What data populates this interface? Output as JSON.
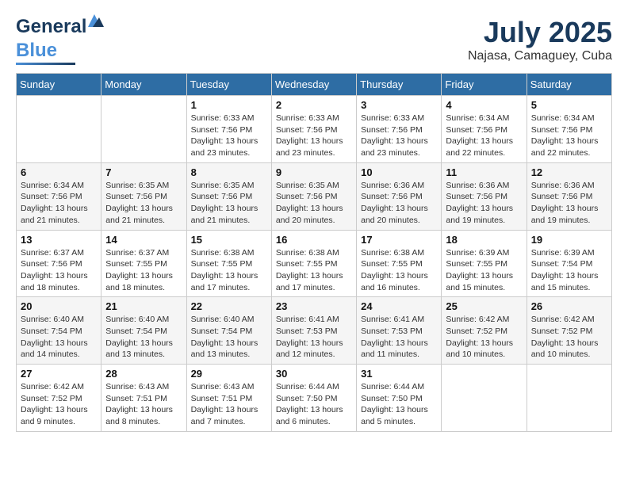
{
  "header": {
    "logo_line1": "General",
    "logo_line2": "Blue",
    "month_year": "July 2025",
    "location": "Najasa, Camaguey, Cuba"
  },
  "days_of_week": [
    "Sunday",
    "Monday",
    "Tuesday",
    "Wednesday",
    "Thursday",
    "Friday",
    "Saturday"
  ],
  "weeks": [
    [
      {
        "day": "",
        "info": ""
      },
      {
        "day": "",
        "info": ""
      },
      {
        "day": "1",
        "info": "Sunrise: 6:33 AM\nSunset: 7:56 PM\nDaylight: 13 hours\nand 23 minutes."
      },
      {
        "day": "2",
        "info": "Sunrise: 6:33 AM\nSunset: 7:56 PM\nDaylight: 13 hours\nand 23 minutes."
      },
      {
        "day": "3",
        "info": "Sunrise: 6:33 AM\nSunset: 7:56 PM\nDaylight: 13 hours\nand 23 minutes."
      },
      {
        "day": "4",
        "info": "Sunrise: 6:34 AM\nSunset: 7:56 PM\nDaylight: 13 hours\nand 22 minutes."
      },
      {
        "day": "5",
        "info": "Sunrise: 6:34 AM\nSunset: 7:56 PM\nDaylight: 13 hours\nand 22 minutes."
      }
    ],
    [
      {
        "day": "6",
        "info": "Sunrise: 6:34 AM\nSunset: 7:56 PM\nDaylight: 13 hours\nand 21 minutes."
      },
      {
        "day": "7",
        "info": "Sunrise: 6:35 AM\nSunset: 7:56 PM\nDaylight: 13 hours\nand 21 minutes."
      },
      {
        "day": "8",
        "info": "Sunrise: 6:35 AM\nSunset: 7:56 PM\nDaylight: 13 hours\nand 21 minutes."
      },
      {
        "day": "9",
        "info": "Sunrise: 6:35 AM\nSunset: 7:56 PM\nDaylight: 13 hours\nand 20 minutes."
      },
      {
        "day": "10",
        "info": "Sunrise: 6:36 AM\nSunset: 7:56 PM\nDaylight: 13 hours\nand 20 minutes."
      },
      {
        "day": "11",
        "info": "Sunrise: 6:36 AM\nSunset: 7:56 PM\nDaylight: 13 hours\nand 19 minutes."
      },
      {
        "day": "12",
        "info": "Sunrise: 6:36 AM\nSunset: 7:56 PM\nDaylight: 13 hours\nand 19 minutes."
      }
    ],
    [
      {
        "day": "13",
        "info": "Sunrise: 6:37 AM\nSunset: 7:56 PM\nDaylight: 13 hours\nand 18 minutes."
      },
      {
        "day": "14",
        "info": "Sunrise: 6:37 AM\nSunset: 7:55 PM\nDaylight: 13 hours\nand 18 minutes."
      },
      {
        "day": "15",
        "info": "Sunrise: 6:38 AM\nSunset: 7:55 PM\nDaylight: 13 hours\nand 17 minutes."
      },
      {
        "day": "16",
        "info": "Sunrise: 6:38 AM\nSunset: 7:55 PM\nDaylight: 13 hours\nand 17 minutes."
      },
      {
        "day": "17",
        "info": "Sunrise: 6:38 AM\nSunset: 7:55 PM\nDaylight: 13 hours\nand 16 minutes."
      },
      {
        "day": "18",
        "info": "Sunrise: 6:39 AM\nSunset: 7:55 PM\nDaylight: 13 hours\nand 15 minutes."
      },
      {
        "day": "19",
        "info": "Sunrise: 6:39 AM\nSunset: 7:54 PM\nDaylight: 13 hours\nand 15 minutes."
      }
    ],
    [
      {
        "day": "20",
        "info": "Sunrise: 6:40 AM\nSunset: 7:54 PM\nDaylight: 13 hours\nand 14 minutes."
      },
      {
        "day": "21",
        "info": "Sunrise: 6:40 AM\nSunset: 7:54 PM\nDaylight: 13 hours\nand 13 minutes."
      },
      {
        "day": "22",
        "info": "Sunrise: 6:40 AM\nSunset: 7:54 PM\nDaylight: 13 hours\nand 13 minutes."
      },
      {
        "day": "23",
        "info": "Sunrise: 6:41 AM\nSunset: 7:53 PM\nDaylight: 13 hours\nand 12 minutes."
      },
      {
        "day": "24",
        "info": "Sunrise: 6:41 AM\nSunset: 7:53 PM\nDaylight: 13 hours\nand 11 minutes."
      },
      {
        "day": "25",
        "info": "Sunrise: 6:42 AM\nSunset: 7:52 PM\nDaylight: 13 hours\nand 10 minutes."
      },
      {
        "day": "26",
        "info": "Sunrise: 6:42 AM\nSunset: 7:52 PM\nDaylight: 13 hours\nand 10 minutes."
      }
    ],
    [
      {
        "day": "27",
        "info": "Sunrise: 6:42 AM\nSunset: 7:52 PM\nDaylight: 13 hours\nand 9 minutes."
      },
      {
        "day": "28",
        "info": "Sunrise: 6:43 AM\nSunset: 7:51 PM\nDaylight: 13 hours\nand 8 minutes."
      },
      {
        "day": "29",
        "info": "Sunrise: 6:43 AM\nSunset: 7:51 PM\nDaylight: 13 hours\nand 7 minutes."
      },
      {
        "day": "30",
        "info": "Sunrise: 6:44 AM\nSunset: 7:50 PM\nDaylight: 13 hours\nand 6 minutes."
      },
      {
        "day": "31",
        "info": "Sunrise: 6:44 AM\nSunset: 7:50 PM\nDaylight: 13 hours\nand 5 minutes."
      },
      {
        "day": "",
        "info": ""
      },
      {
        "day": "",
        "info": ""
      }
    ]
  ]
}
